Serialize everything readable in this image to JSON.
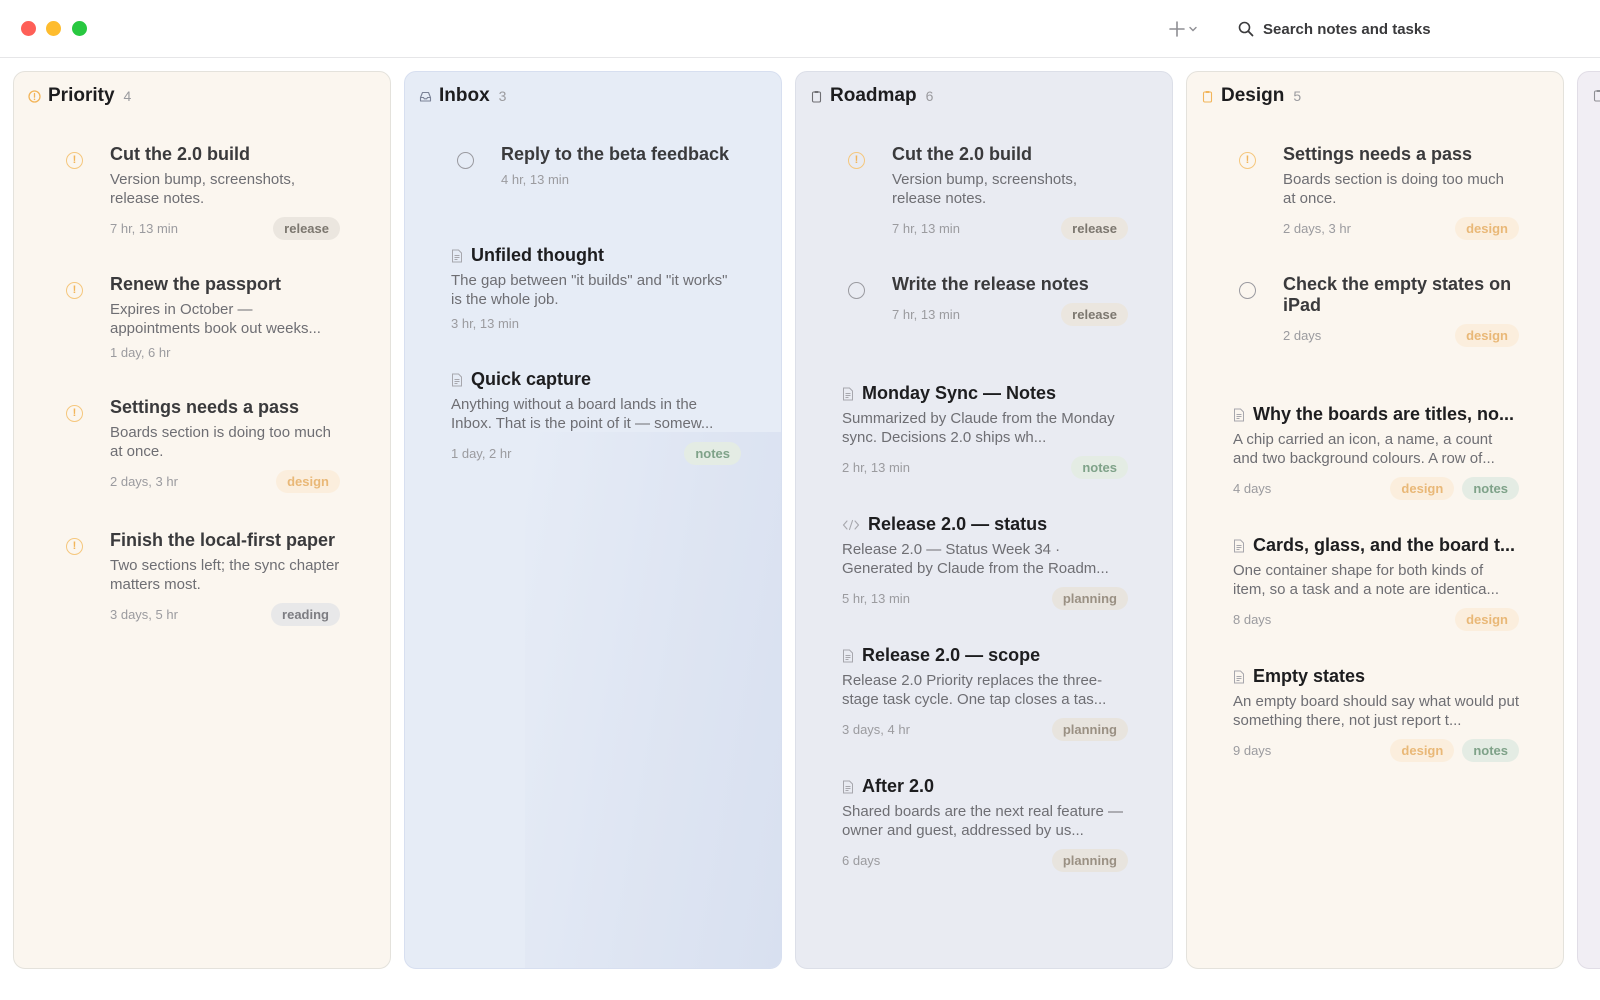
{
  "toolbar": {
    "search_placeholder": "Search notes and tasks",
    "add_icon": "plus-icon",
    "add_menu_icon": "chevron-down-icon",
    "search_icon": "magnifier-icon"
  },
  "boards": {
    "priority": {
      "title": "Priority",
      "count": "4",
      "icon": "priority-icon",
      "cards": [
        {
          "title": "Cut the 2.0 build",
          "body": "Version bump, screenshots, release notes.",
          "meta": "7 hr, 13 min",
          "tags": [
            "release"
          ]
        },
        {
          "title": "Renew the passport",
          "body": "Expires in October — appointments book out weeks...",
          "meta": "1 day, 6 hr",
          "tags": []
        },
        {
          "title": "Settings needs a pass",
          "body": "Boards section is doing too much at once.",
          "meta": "2 days, 3 hr",
          "tags": [
            "design"
          ]
        },
        {
          "title": "Finish the local-first paper",
          "body": "Two sections left; the sync chapter matters most.",
          "meta": "3 days, 5 hr",
          "tags": [
            "reading"
          ]
        }
      ]
    },
    "inbox": {
      "title": "Inbox",
      "count": "3",
      "icon": "inbox-tray-icon",
      "cards": [
        {
          "title": "Reply to the beta feedback",
          "body": "",
          "meta": "4 hr, 13 min",
          "tags": []
        },
        {
          "title": "Unfiled thought",
          "body": "The gap between \"it builds\" and \"it works\" is the whole job.",
          "meta": "3 hr, 13 min",
          "tags": []
        },
        {
          "title": "Quick capture",
          "body": "Anything without a board lands in the Inbox. That is the point of it — somew...",
          "meta": "1 day, 2 hr",
          "tags": [
            "notes"
          ]
        }
      ]
    },
    "roadmap": {
      "title": "Roadmap",
      "count": "6",
      "icon": "clipboard-icon",
      "cards": [
        {
          "title": "Cut the 2.0 build",
          "body": "Version bump, screenshots, release notes.",
          "meta": "7 hr, 13 min",
          "tags": [
            "release"
          ]
        },
        {
          "title": "Write the release notes",
          "body": "",
          "meta": "7 hr, 13 min",
          "tags": [
            "release"
          ]
        },
        {
          "title": "Monday Sync — Notes",
          "body": "Summarized by Claude from the Monday sync. Decisions 2.0 ships wh...",
          "meta": "2 hr, 13 min",
          "tags": [
            "notes"
          ]
        },
        {
          "title": "Release 2.0 — status",
          "body": "Release 2.0 — Status Week 34 · Generated by Claude from the Roadm...",
          "meta": "5 hr, 13 min",
          "tags": [
            "planning"
          ]
        },
        {
          "title": "Release 2.0 — scope",
          "body": "Release 2.0 Priority replaces the three-stage task cycle. One tap closes a tas...",
          "meta": "3 days, 4 hr",
          "tags": [
            "planning"
          ]
        },
        {
          "title": "After 2.0",
          "body": "Shared boards are the next real feature — owner and guest, addressed by us...",
          "meta": "6 days",
          "tags": [
            "planning"
          ]
        }
      ]
    },
    "design": {
      "title": "Design",
      "count": "5",
      "icon": "clipboard-icon",
      "cards": [
        {
          "title": "Settings needs a pass",
          "body": "Boards section is doing too much at once.",
          "meta": "2 days, 3 hr",
          "tags": [
            "design"
          ]
        },
        {
          "title": "Check the empty states on iPad",
          "body": "",
          "meta": "2 days",
          "tags": [
            "design"
          ]
        },
        {
          "title": "Why the boards are titles, no...",
          "body": "A chip carried an icon, a name, a count and two background colours. A row of...",
          "meta": "4 days",
          "tags": [
            "design",
            "notes"
          ]
        },
        {
          "title": "Cards, glass, and the board t...",
          "body": "One container shape for both kinds of item, so a task and a note are identica...",
          "meta": "8 days",
          "tags": [
            "design"
          ]
        },
        {
          "title": "Empty states",
          "body": "An empty board should say what would put something there, not just report t...",
          "meta": "9 days",
          "tags": [
            "design",
            "notes"
          ]
        }
      ]
    }
  },
  "colors": {
    "priority_bg": "#fbf6ef",
    "inbox_bg": "#e6ecf6",
    "roadmap_bg": "#e9ebf2",
    "design_bg": "#fbf6ef",
    "priority_marker": "#f2b55a"
  }
}
